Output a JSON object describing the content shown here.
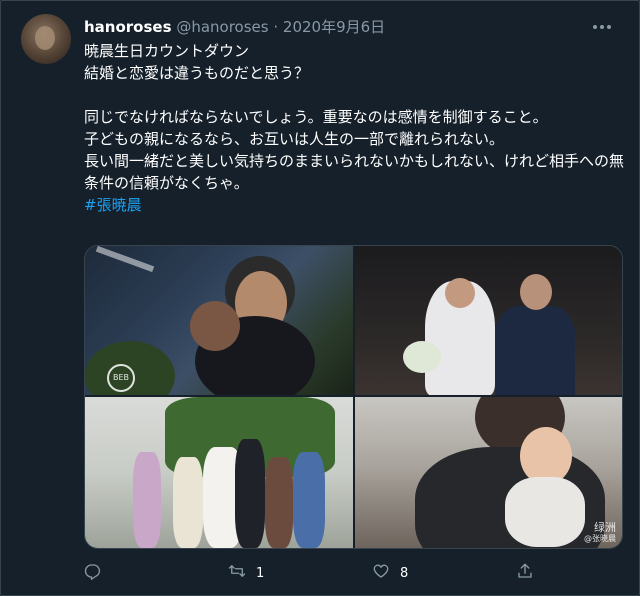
{
  "user": {
    "display_name": "hanoroses",
    "handle": "@hanoroses",
    "separator": "·",
    "date": "2020年9月6日"
  },
  "tweet": {
    "lines": [
      "暁晨生日カウントダウン",
      "結婚と恋愛は違うものだと思う？",
      "同じでなければならないでしょう。重要なのは感情を制御すること。",
      "子どもの親になるなら、お互いは人生の一部で離れられない。",
      "長い間一緒だと美しい気持ちのままいられないかもしれない、けれど相手への無条件の信頼がなくちゃ。"
    ],
    "hashtag": "#張暁晨"
  },
  "media": {
    "watermark_tl": "BEB",
    "watermark_br": "绿洲",
    "watermark_br_sub": "@张晓晨"
  },
  "actions": {
    "reply_icon": "reply-icon",
    "retweet_icon": "retweet-icon",
    "retweet_count": "1",
    "like_icon": "heart-icon",
    "like_count": "8",
    "share_icon": "share-icon"
  },
  "colors": {
    "background": "#15202b",
    "secondary_text": "#8899a6",
    "link": "#1da1f2",
    "border": "#38444d"
  }
}
